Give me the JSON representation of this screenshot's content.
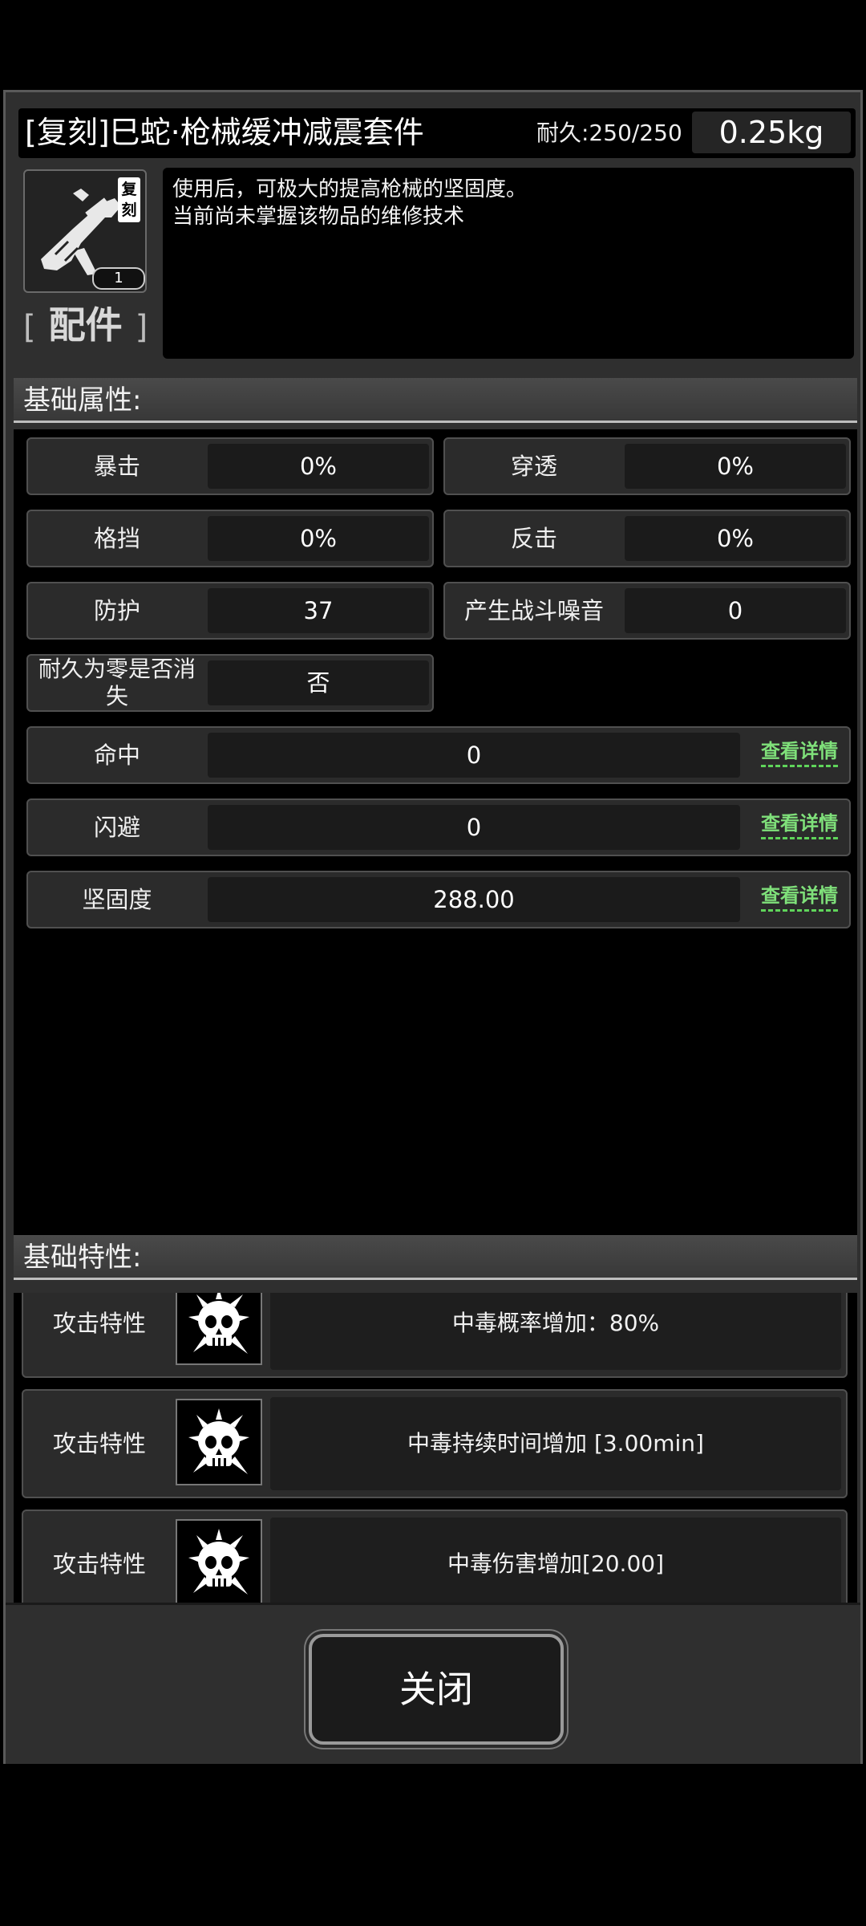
{
  "header": {
    "title": "[复刻]巳蛇·枪械缓冲减震套件",
    "durability": "耐久:250/250",
    "weight": "0.25kg"
  },
  "item": {
    "icon": "gun-stock-icon",
    "copy_badge": "复刻",
    "quantity": "1",
    "category_open": "[",
    "category": "配件",
    "category_close": "]",
    "description": [
      "使用后，可极大的提高枪械的坚固度。",
      "当前尚未掌握该物品的维修技术"
    ]
  },
  "sections": {
    "basic_attributes": "基础属性:",
    "basic_traits": "基础特性:"
  },
  "attributes": [
    {
      "label": "暴击",
      "value": "0%"
    },
    {
      "label": "穿透",
      "value": "0%"
    },
    {
      "label": "格挡",
      "value": "0%"
    },
    {
      "label": "反击",
      "value": "0%"
    },
    {
      "label": "防护",
      "value": "37"
    },
    {
      "label": "产生战斗噪音",
      "value": "0"
    },
    {
      "label": "耐久为零是否消失",
      "value": "否"
    }
  ],
  "detail_attributes": [
    {
      "label": "命中",
      "value": "0",
      "link": "查看详情"
    },
    {
      "label": "闪避",
      "value": "0",
      "link": "查看详情"
    },
    {
      "label": "坚固度",
      "value": "288.00",
      "link": "查看详情"
    }
  ],
  "traits": [
    {
      "label": "攻击特性",
      "icon": "poison-skull-icon",
      "text": "中毒概率增加：80%"
    },
    {
      "label": "攻击特性",
      "icon": "poison-skull-icon",
      "text": "中毒持续时间增加 [3.00min]"
    },
    {
      "label": "攻击特性",
      "icon": "poison-skull-icon",
      "text": "中毒伤害增加[20.00]"
    }
  ],
  "footer": {
    "close_label": "关闭"
  }
}
